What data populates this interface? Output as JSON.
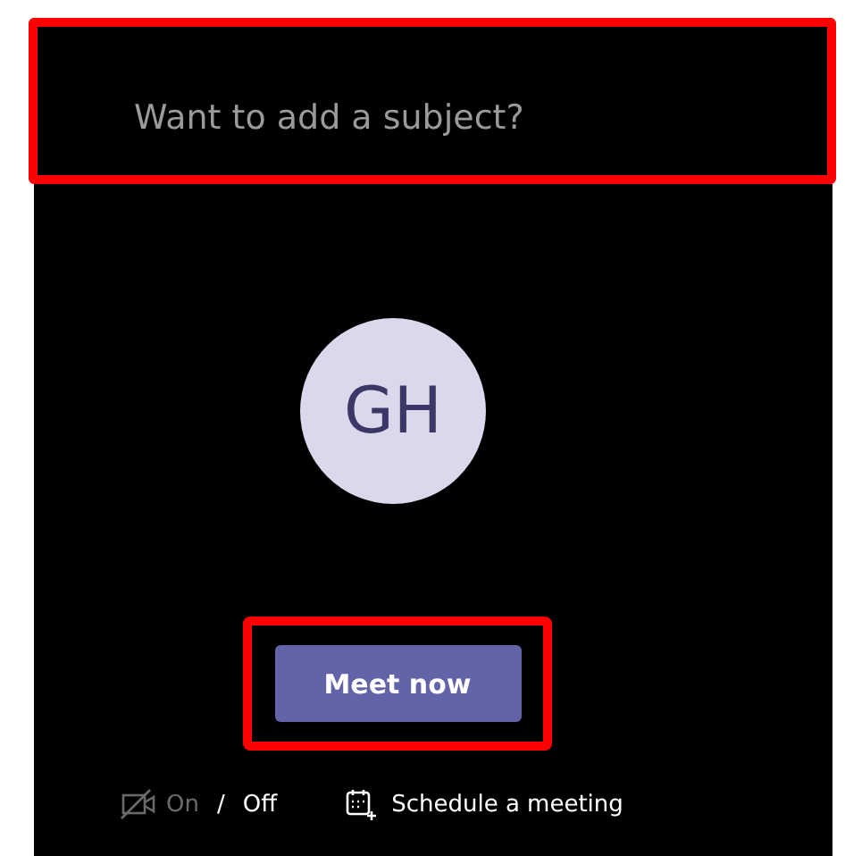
{
  "subject": {
    "placeholder": "Want to add a subject?"
  },
  "avatar": {
    "initials": "GH"
  },
  "meet_button": {
    "label": "Meet now"
  },
  "camera": {
    "options": [
      {
        "label": "On",
        "selected": false
      },
      {
        "label": "Off",
        "selected": true
      }
    ],
    "separator": "/"
  },
  "schedule_link": {
    "label": "Schedule a meeting"
  }
}
